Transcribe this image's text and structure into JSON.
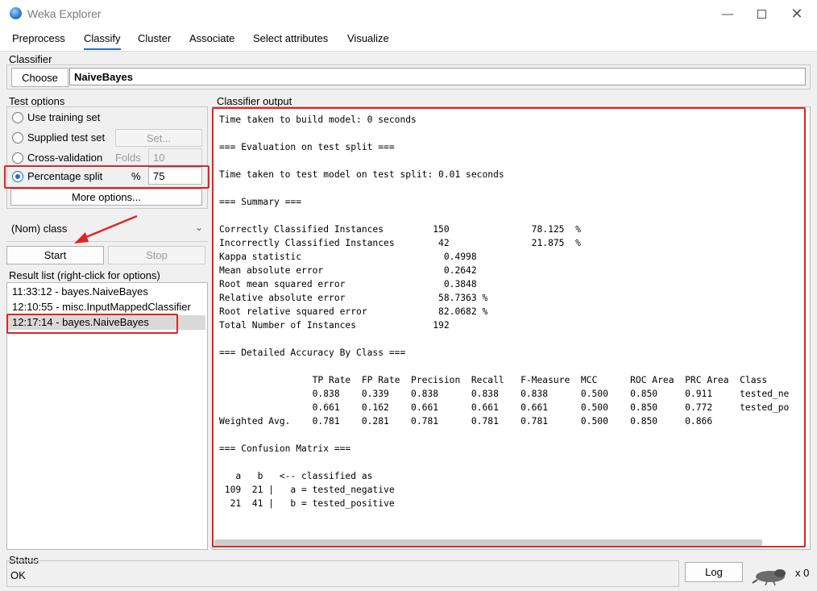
{
  "window": {
    "title": "Weka Explorer",
    "icon": "weka-bird-icon",
    "controls": [
      "minimize-icon",
      "maximize-icon",
      "close-icon"
    ]
  },
  "tabs": [
    {
      "label": "Preprocess"
    },
    {
      "label": "Classify",
      "active": true
    },
    {
      "label": "Cluster"
    },
    {
      "label": "Associate"
    },
    {
      "label": "Select attributes"
    },
    {
      "label": "Visualize"
    }
  ],
  "classifier": {
    "section_label": "Classifier",
    "choose_label": "Choose",
    "name": "NaiveBayes"
  },
  "test_options": {
    "section_label": "Test options",
    "use_training_set": "Use training set",
    "supplied_test_set": "Supplied test set",
    "set_button": "Set...",
    "cross_validation": "Cross-validation",
    "folds_label": "Folds",
    "folds_value": "10",
    "percentage_split": "Percentage split",
    "percent_sign": "%",
    "percent_value": "75",
    "selected": "percentage_split",
    "more_options": "More options..."
  },
  "class_select": {
    "value": "(Nom) class"
  },
  "actions": {
    "start": "Start",
    "stop": "Stop"
  },
  "result_list": {
    "label": "Result list (right-click for options)",
    "items": [
      {
        "text": "11:33:12 - bayes.NaiveBayes"
      },
      {
        "text": "12:10:55 - misc.InputMappedClassifier"
      },
      {
        "text": "12:17:14 - bayes.NaiveBayes",
        "selected": true
      }
    ]
  },
  "output": {
    "label": "Classifier output",
    "text": "Time taken to build model: 0 seconds\n\n=== Evaluation on test split ===\n\nTime taken to test model on test split: 0.01 seconds\n\n=== Summary ===\n\nCorrectly Classified Instances         150               78.125  %\nIncorrectly Classified Instances        42               21.875  %\nKappa statistic                          0.4998\nMean absolute error                      0.2642\nRoot mean squared error                  0.3848\nRelative absolute error                 58.7363 %\nRoot relative squared error             82.0682 %\nTotal Number of Instances              192     \n\n=== Detailed Accuracy By Class ===\n\n                 TP Rate  FP Rate  Precision  Recall   F-Measure  MCC      ROC Area  PRC Area  Class\n                 0.838    0.339    0.838      0.838    0.838      0.500    0.850     0.911     tested_ne\n                 0.661    0.162    0.661      0.661    0.661      0.500    0.850     0.772     tested_po\nWeighted Avg.    0.781    0.281    0.781      0.781    0.781      0.500    0.850     0.866     \n\n=== Confusion Matrix ===\n\n   a   b   <-- classified as\n 109  21 |   a = tested_negative\n  21  41 |   b = tested_positive"
  },
  "status": {
    "label": "Status",
    "text": "OK",
    "log_button": "Log",
    "worker_icon": "weka-bird-icon",
    "x_count": "x 0"
  },
  "colors": {
    "annotation_red": "#e02424",
    "accent_blue": "#1f6fd0"
  }
}
